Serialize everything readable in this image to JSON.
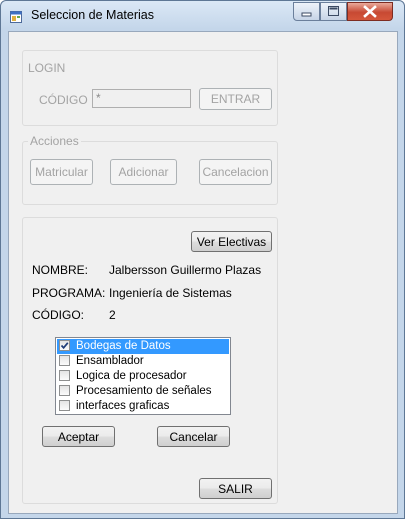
{
  "window": {
    "title": "Seleccion de Materias",
    "icon": "app-form-icon",
    "controls": [
      "minimize-icon",
      "maximize-icon",
      "close-icon"
    ]
  },
  "login": {
    "legend": "LOGIN",
    "codigo_label": "CÓDIGO",
    "codigo_value": "*",
    "entrar_label": "ENTRAR"
  },
  "acciones": {
    "legend": "Acciones",
    "matricular_label": "Matricular",
    "adicionar_label": "Adicionar",
    "cancelacion_label": "Cancelacion"
  },
  "student": {
    "ver_electivas_label": "Ver Electivas",
    "nombre_label": "NOMBRE:",
    "nombre_value": "Jalbersson Guillermo Plazas",
    "programa_label": "PROGRAMA:",
    "programa_value": "Ingeniería de Sistemas",
    "codigo_label": "CÓDIGO:",
    "codigo_value": "2"
  },
  "electivas": {
    "items": [
      {
        "label": "Bodegas de Datos",
        "checked": true,
        "selected": true
      },
      {
        "label": "Ensamblador",
        "checked": false,
        "selected": false
      },
      {
        "label": "Logica de procesador",
        "checked": false,
        "selected": false
      },
      {
        "label": "Procesamiento de señales",
        "checked": false,
        "selected": false
      },
      {
        "label": "interfaces graficas",
        "checked": false,
        "selected": false
      }
    ],
    "aceptar_label": "Aceptar",
    "cancelar_label": "Cancelar"
  },
  "salir_label": "SALIR",
  "colors": {
    "selection": "#3399ff",
    "disabled_text": "#a3a3a3",
    "frame": "#c4d6ea",
    "close_button": "#c74933"
  }
}
